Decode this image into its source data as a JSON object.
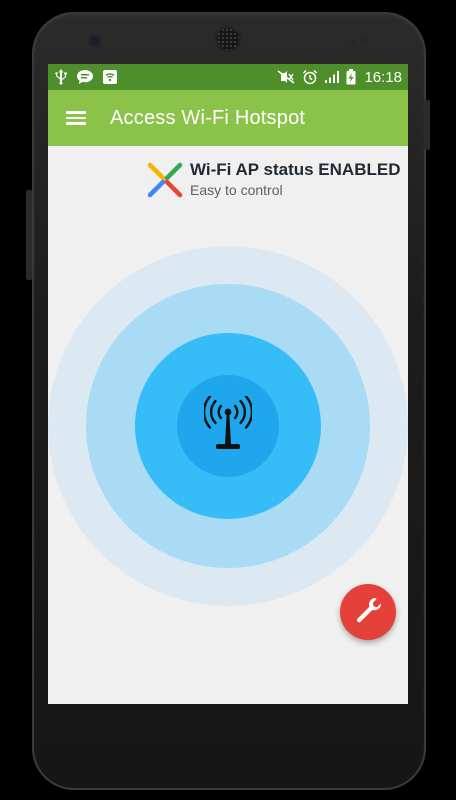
{
  "status_bar": {
    "icons_left": [
      "usb-icon",
      "chat-icon",
      "wifi-hotspot-icon"
    ],
    "icons_right": [
      "mute-icon",
      "alarm-icon",
      "signal-icon",
      "battery-charging-icon"
    ],
    "time": "16:18"
  },
  "app_bar": {
    "title": "Access Wi-Fi Hotspot"
  },
  "status_card": {
    "title": "Wi-Fi AP status ENABLED",
    "subtitle": "Easy to control"
  },
  "colors": {
    "status_bar": "#4e8f2b",
    "app_bar": "#8bc34a",
    "ring_outer": "#dde9f2",
    "ring_mid": "#a9dbf5",
    "ring_inner": "#36bcf6",
    "ring_core": "#1ea7ec",
    "fab": "#e5413b"
  },
  "center_button": {
    "icon": "antenna-icon"
  },
  "fab": {
    "icon": "wrench-icon"
  }
}
